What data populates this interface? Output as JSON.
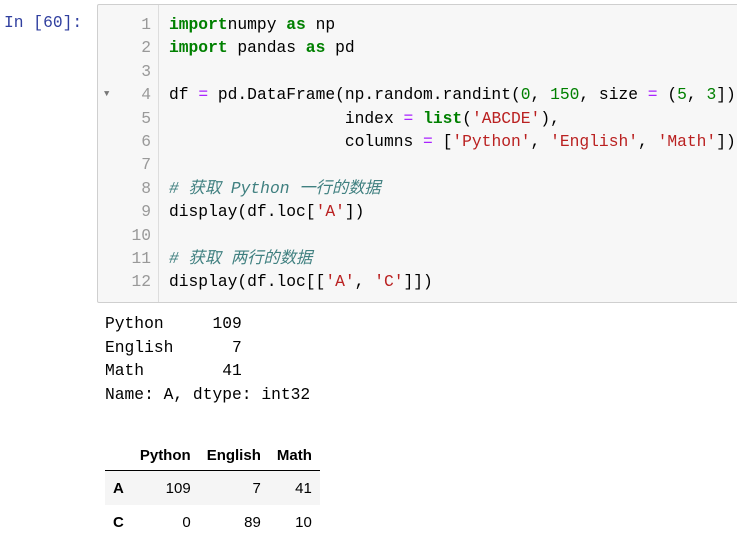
{
  "prompt": "In  [60]:",
  "code_lines": [
    [
      [
        "kw",
        "import"
      ],
      [
        "",
        "numpy "
      ],
      [
        "kw",
        "as"
      ],
      [
        "",
        " np"
      ]
    ],
    [
      [
        "kw",
        "import"
      ],
      [
        "",
        " pandas "
      ],
      [
        "kw",
        "as"
      ],
      [
        "",
        " pd"
      ]
    ],
    [],
    [
      [
        "",
        "df "
      ],
      [
        "op",
        "="
      ],
      [
        "",
        " pd.DataFrame(np.random.randint("
      ],
      [
        "num",
        "0"
      ],
      [
        "",
        ", "
      ],
      [
        "num",
        "150"
      ],
      [
        "",
        ", size "
      ],
      [
        "op",
        "="
      ],
      [
        "",
        " ("
      ],
      [
        "num",
        "5"
      ],
      [
        "",
        ", "
      ],
      [
        "num",
        "3"
      ],
      [
        "",
        "]),"
      ]
    ],
    [
      [
        "",
        "                  index "
      ],
      [
        "op",
        "="
      ],
      [
        "",
        " "
      ],
      [
        "kw",
        "list"
      ],
      [
        "",
        "("
      ],
      [
        "str",
        "'ABCDE'"
      ],
      [
        "",
        "),"
      ]
    ],
    [
      [
        "",
        "                  columns "
      ],
      [
        "op",
        "="
      ],
      [
        "",
        " ["
      ],
      [
        "str",
        "'Python'"
      ],
      [
        "",
        ", "
      ],
      [
        "str",
        "'English'"
      ],
      [
        "",
        ", "
      ],
      [
        "str",
        "'Math'"
      ],
      [
        "",
        "])"
      ]
    ],
    [],
    [
      [
        "com",
        "# 获取 Python 一行的数据"
      ]
    ],
    [
      [
        "",
        "display(df.loc["
      ],
      [
        "str",
        "'A'"
      ],
      [
        "",
        "])"
      ]
    ],
    [],
    [
      [
        "com",
        "# 获取 两行的数据"
      ]
    ],
    [
      [
        "",
        "display(df.loc[["
      ],
      [
        "str",
        "'A'"
      ],
      [
        "",
        ", "
      ],
      [
        "str",
        "'C'"
      ],
      [
        "",
        "]])"
      ]
    ]
  ],
  "series_output": "Python     109\nEnglish      7\nMath        41\nName: A, dtype: int32",
  "table": {
    "columns": [
      "",
      "Python",
      "English",
      "Math"
    ],
    "rows": [
      {
        "index": "A",
        "values": [
          "109",
          "7",
          "41"
        ]
      },
      {
        "index": "C",
        "values": [
          "0",
          "89",
          "10"
        ]
      }
    ]
  }
}
